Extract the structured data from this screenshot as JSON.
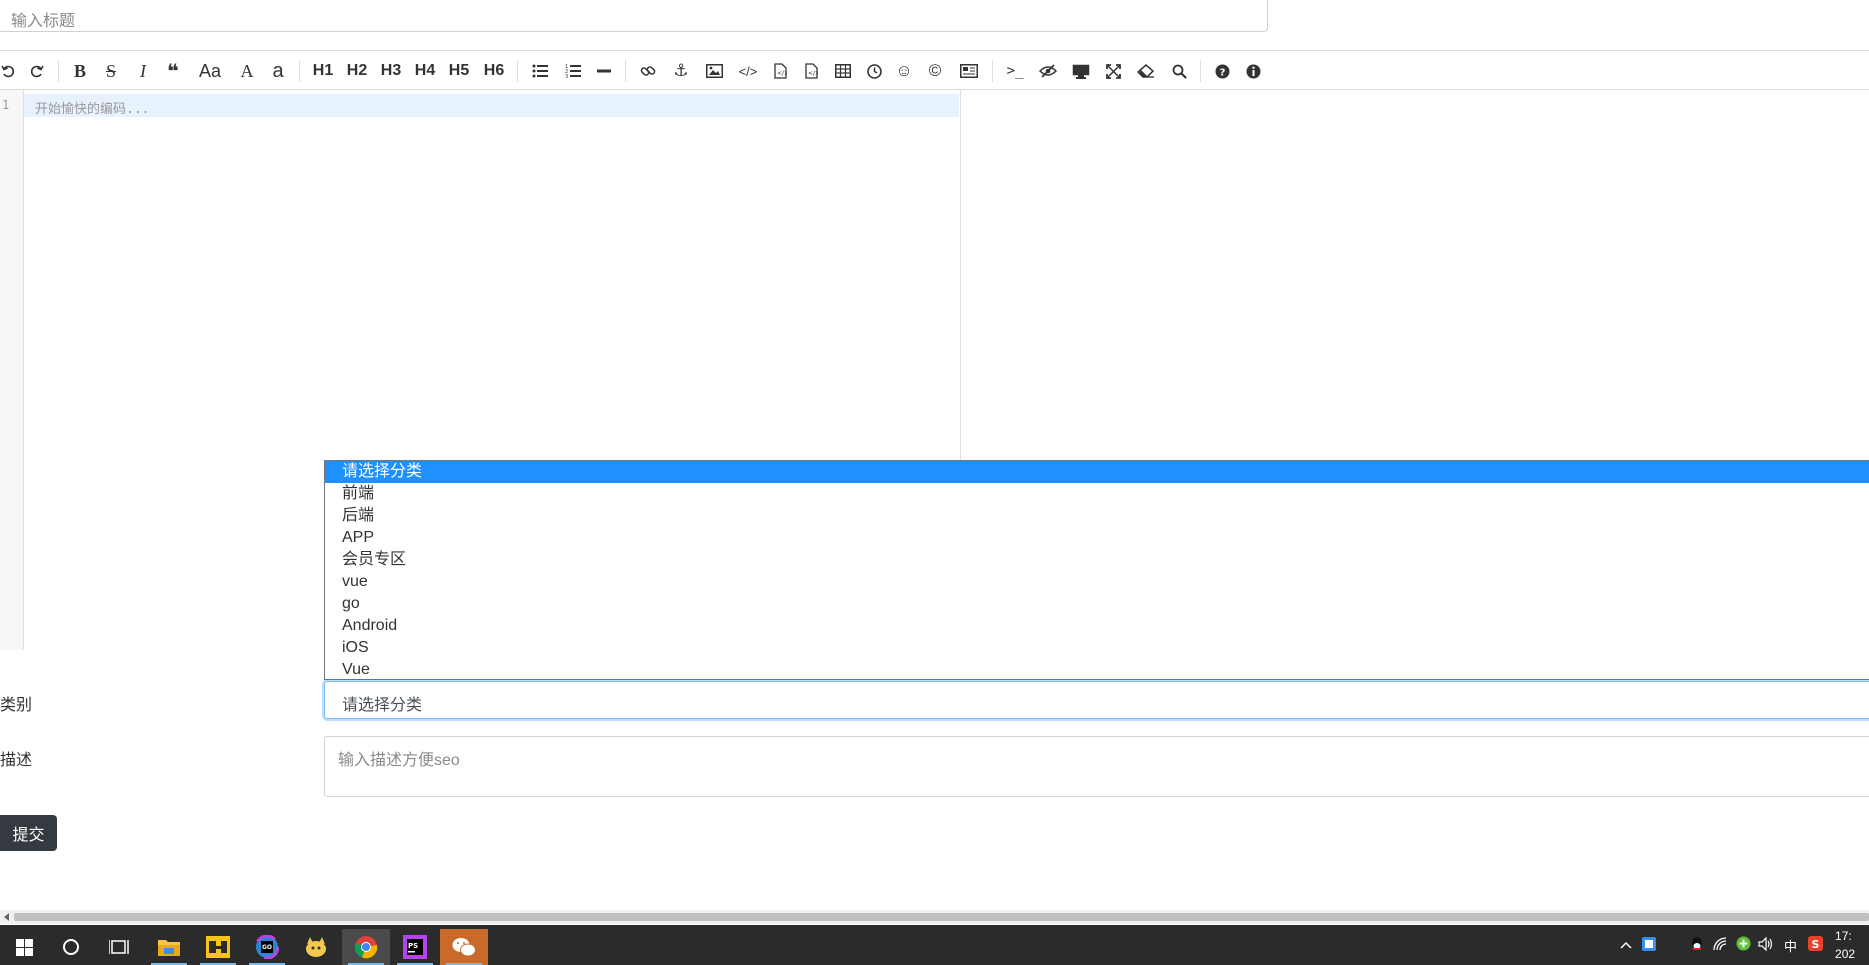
{
  "title_input": {
    "placeholder": "输入标题"
  },
  "toolbar": {
    "items": [
      {
        "name": "undo-icon",
        "glyph": "↺"
      },
      {
        "name": "redo-icon",
        "glyph": "↻"
      },
      {
        "name": "bold-icon",
        "glyph": "B"
      },
      {
        "name": "strikethrough-icon",
        "glyph": "S"
      },
      {
        "name": "italic-icon",
        "glyph": "I"
      },
      {
        "name": "quote-icon",
        "glyph": "❝"
      },
      {
        "name": "uppercase-icon",
        "glyph": "Aa"
      },
      {
        "name": "uppercase-first-icon",
        "glyph": "A"
      },
      {
        "name": "lowercase-icon",
        "glyph": "a"
      },
      {
        "name": "h1-button",
        "glyph": "H1"
      },
      {
        "name": "h2-button",
        "glyph": "H2"
      },
      {
        "name": "h3-button",
        "glyph": "H3"
      },
      {
        "name": "h4-button",
        "glyph": "H4"
      },
      {
        "name": "h5-button",
        "glyph": "H5"
      },
      {
        "name": "h6-button",
        "glyph": "H6"
      },
      {
        "name": "unordered-list-icon",
        "glyph": "☰"
      },
      {
        "name": "ordered-list-icon",
        "glyph": "≣"
      },
      {
        "name": "horizontal-rule-icon",
        "glyph": "—"
      },
      {
        "name": "link-icon",
        "glyph": "🔗"
      },
      {
        "name": "anchor-icon",
        "glyph": "⚓"
      },
      {
        "name": "image-icon",
        "glyph": "▣"
      },
      {
        "name": "code-icon",
        "glyph": "</>"
      },
      {
        "name": "preformatted-text-icon",
        "glyph": "▤"
      },
      {
        "name": "code-block-icon",
        "glyph": "▤"
      },
      {
        "name": "table-icon",
        "glyph": "▦"
      },
      {
        "name": "datetime-icon",
        "glyph": "◷"
      },
      {
        "name": "emoji-icon",
        "glyph": "☺"
      },
      {
        "name": "html-entities-icon",
        "glyph": "©"
      },
      {
        "name": "pagebreak-icon",
        "glyph": "▭"
      },
      {
        "name": "goto-line-icon",
        "glyph": ">_"
      },
      {
        "name": "watch-toggle-icon",
        "glyph": "⊘"
      },
      {
        "name": "preview-icon",
        "glyph": "▭"
      },
      {
        "name": "fullscreen-icon",
        "glyph": "⤢"
      },
      {
        "name": "clear-icon",
        "glyph": "⌫"
      },
      {
        "name": "search-icon",
        "glyph": "⌕"
      },
      {
        "name": "help-icon",
        "glyph": "?"
      },
      {
        "name": "info-icon",
        "glyph": "i"
      }
    ]
  },
  "editor": {
    "line_number": "1",
    "placeholder": "开始愉快的编码..."
  },
  "category": {
    "label": "类别",
    "selected": "请选择分类",
    "options": [
      "请选择分类",
      "前端",
      "后端",
      "APP",
      "会员专区",
      "vue",
      "go",
      "Android",
      "iOS",
      "Vue"
    ]
  },
  "description": {
    "label": "描述",
    "placeholder": "输入描述方便seo"
  },
  "submit": {
    "label": "提交"
  },
  "taskbar": {
    "tray": {
      "ime": "中",
      "time": "17:",
      "date": "202"
    }
  },
  "colors": {
    "selected_option": "#1e90ff",
    "submit_bg": "#343a40",
    "taskbar_bg": "#2b2b2b"
  }
}
